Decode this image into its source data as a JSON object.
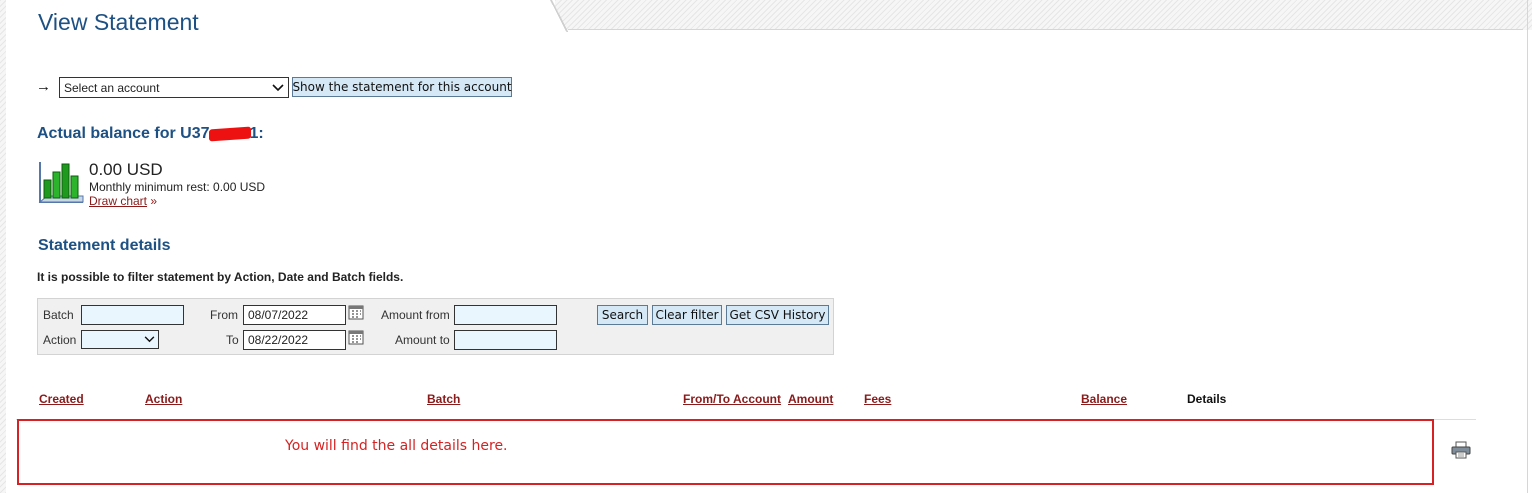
{
  "page": {
    "title": "View Statement"
  },
  "account_selector": {
    "arrow": "→",
    "select_value": "Select an account",
    "show_button": "Show the statement for this account"
  },
  "balance": {
    "title_prefix": "Actual balance for U37",
    "title_suffix": "1:",
    "amount": "0.00 USD",
    "min_rest": "Monthly minimum rest: 0.00 USD",
    "draw_chart_link": "Draw chart",
    "draw_chart_suffix": " »"
  },
  "statement": {
    "title": "Statement details",
    "filter_note": "It is possible to filter statement by Action, Date and Batch fields."
  },
  "filter": {
    "batch_label": "Batch",
    "action_label": "Action",
    "from_label": "From",
    "from_value": "08/07/2022",
    "to_label": "To",
    "to_value": "08/22/2022",
    "amount_from_label": "Amount from",
    "amount_to_label": "Amount to",
    "search_button": "Search",
    "clear_button": "Clear filter",
    "csv_button": "Get CSV History"
  },
  "table": {
    "columns": [
      "Created",
      "Action",
      "Batch",
      "From/To Account",
      "Amount",
      "Fees",
      "Balance",
      "Details"
    ],
    "placeholder_message": "You will find the all details here."
  },
  "colors": {
    "accent": "#1d5083",
    "link": "#8b1a1a",
    "highlight": "#d62222"
  }
}
